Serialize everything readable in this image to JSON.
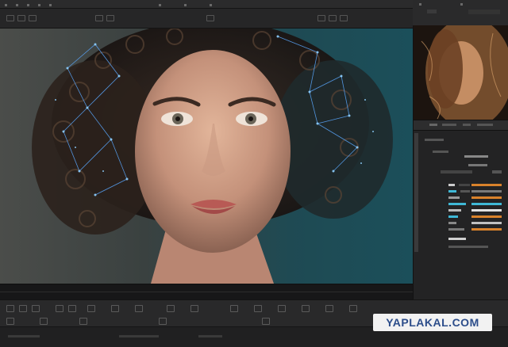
{
  "watermark": {
    "text": "YAPLAKAL.COM"
  },
  "colors": {
    "accent_cyan": "#3fb8d6",
    "accent_orange": "#d9822b",
    "panel_bg": "#232324",
    "network_blue": "#5aa8ff"
  },
  "icons": [
    "menu-icon",
    "play-icon",
    "stop-icon",
    "loop-icon",
    "zoom-icon",
    "settings-icon"
  ]
}
